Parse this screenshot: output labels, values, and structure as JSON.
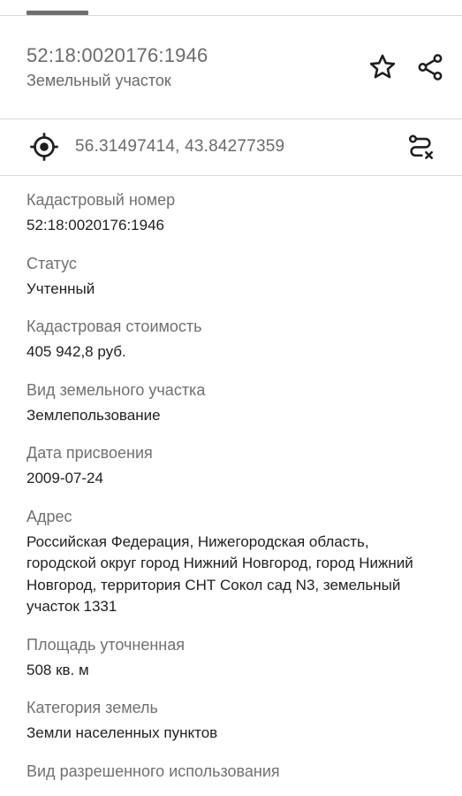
{
  "header": {
    "title": "52:18:0020176:1946",
    "subtitle": "Земельный участок",
    "star_icon": "star-icon",
    "share_icon": "share-icon"
  },
  "coordinates": {
    "text": "56.31497414, 43.84277359",
    "locate_icon": "crosshair-icon",
    "route_icon": "route-icon"
  },
  "fields": [
    {
      "label": "Кадастровый номер",
      "value": "52:18:0020176:1946"
    },
    {
      "label": "Статус",
      "value": "Учтенный"
    },
    {
      "label": "Кадастровая стоимость",
      "value": "405 942,8 руб."
    },
    {
      "label": "Вид земельного участка",
      "value": "Землепользование"
    },
    {
      "label": "Дата присвоения",
      "value": "2009-07-24"
    },
    {
      "label": "Адрес",
      "value": "Российская Федерация, Нижегородская область, городской округ город Нижний Новгород, город Нижний Новгород, территория СНТ Сокол сад N3, земельный участок 1331"
    },
    {
      "label": "Площадь уточненная",
      "value": "508 кв. м"
    },
    {
      "label": "Категория земель",
      "value": "Земли населенных пунктов"
    },
    {
      "label": "Вид разрешенного использования",
      "value": ""
    }
  ],
  "colors": {
    "primary_text": "#1f1f1f",
    "secondary_text": "#6b6b6b",
    "divider": "#d9d9d9",
    "background": "#ffffff"
  }
}
